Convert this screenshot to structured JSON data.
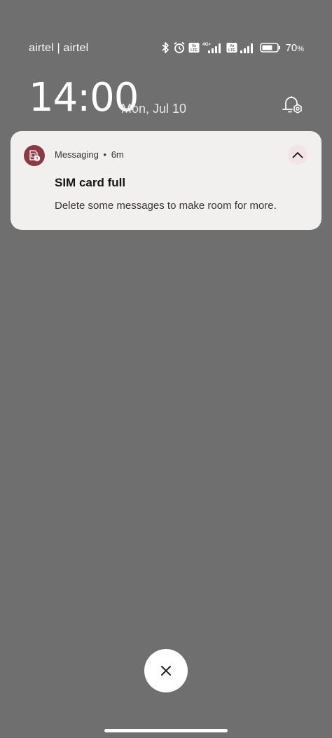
{
  "status_bar": {
    "carrier": "airtel | airtel",
    "battery_percent": "70",
    "battery_unit": "%",
    "sim1_tag": "Vo LTE",
    "sim1_network": "4G+",
    "sim2_tag": "Vo LTE",
    "icons": [
      "bluetooth-icon",
      "alarm-icon",
      "volte-icon",
      "signal-icon",
      "volte-icon",
      "signal-icon",
      "battery-icon"
    ]
  },
  "lockscreen": {
    "time": "14:00",
    "date": "Mon, Jul 10"
  },
  "notification": {
    "app_name": "Messaging",
    "separator": "•",
    "age": "6m",
    "title": "SIM card full",
    "body": "Delete some messages to make room for more.",
    "app_icon_color": "#8b3a45"
  },
  "colors": {
    "background": "#6f6f6f",
    "card": "#f2efef"
  }
}
